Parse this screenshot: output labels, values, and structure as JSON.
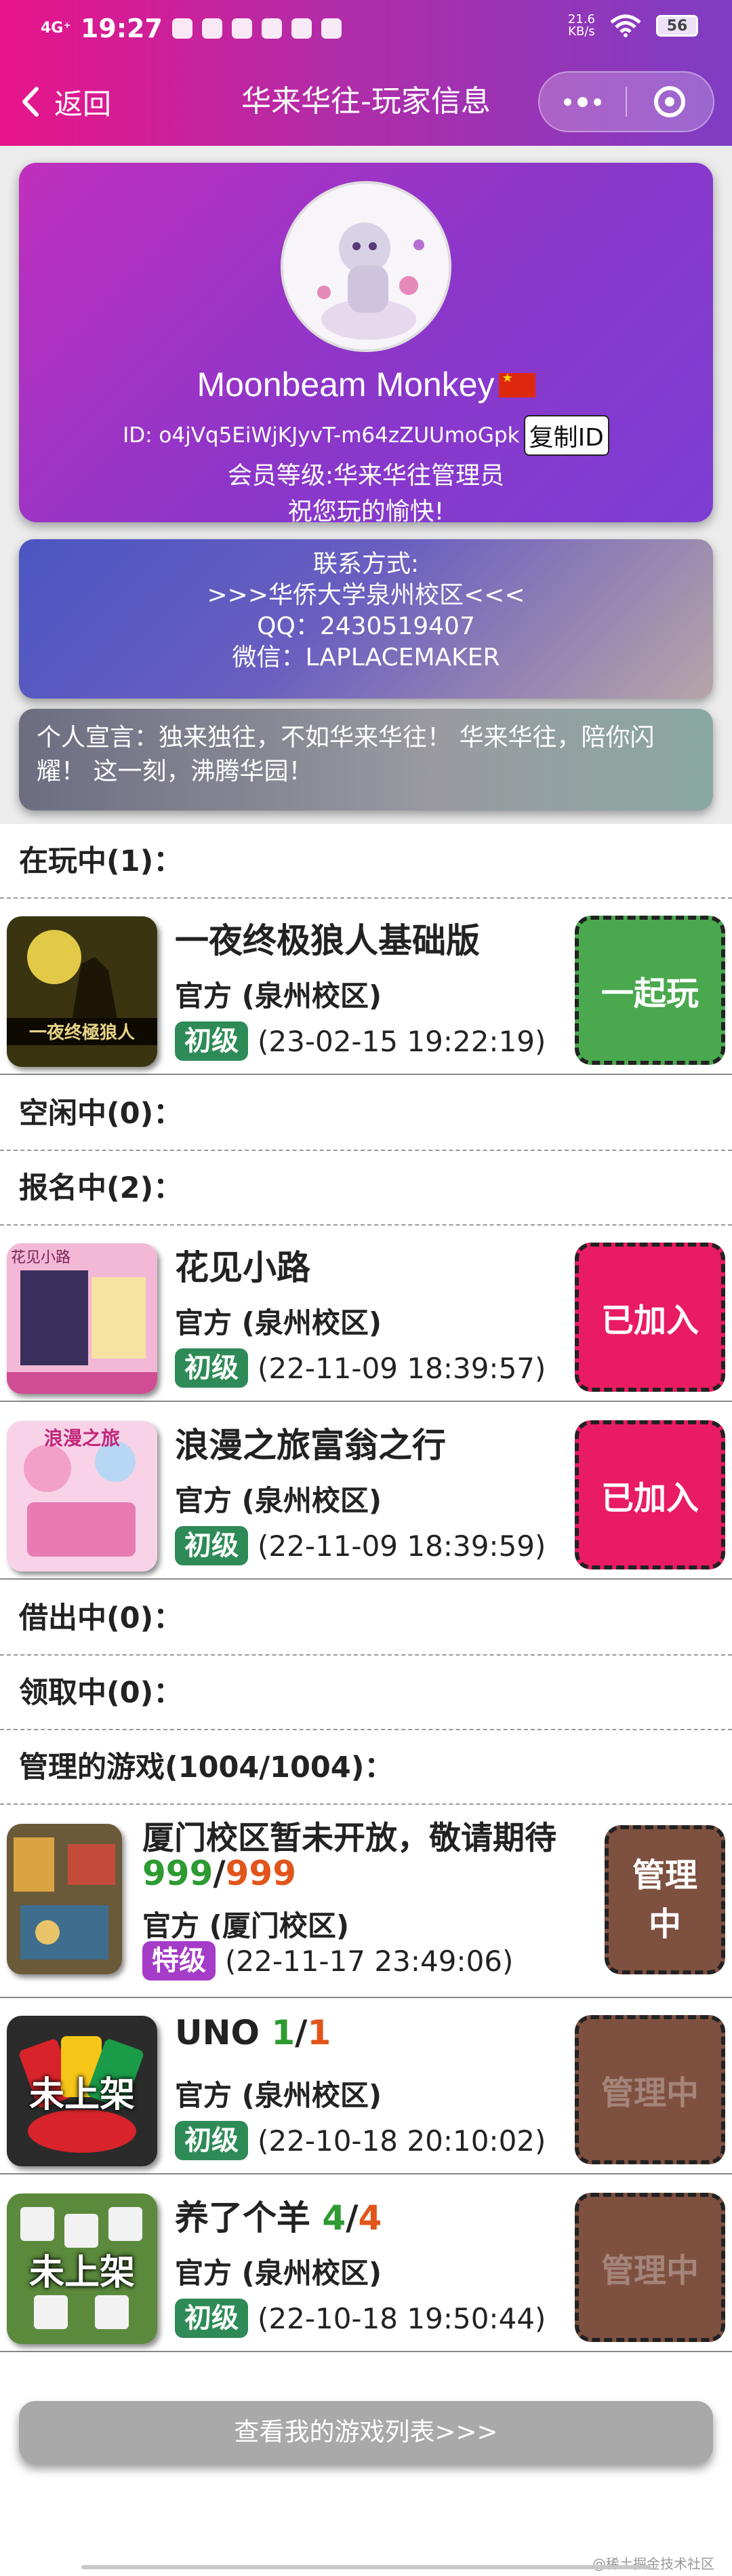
{
  "status_bar": {
    "network": "4G⁺",
    "time": "19:27",
    "netspeed_value": "21.6",
    "netspeed_unit": "KB/s",
    "battery": "56"
  },
  "nav": {
    "back_label": "返回",
    "title": "华来华往-玩家信息"
  },
  "profile": {
    "nickname": "Moonbeam Monkey",
    "id_text": "ID: o4jVq5EiWjKJyvT-m64zZUUmoGpk",
    "copy_id_label": "复制ID",
    "level_text": "会员等级:华来华往管理员",
    "greeting": "祝您玩的愉快!"
  },
  "contact": {
    "title": "联系方式:",
    "campus": ">>>华侨大学泉州校区<<<",
    "qq": "QQ：2430519407",
    "wechat": "微信：LAPLACEMAKER"
  },
  "motto": "个人宣言：独来独往，不如华来华往！ 华来华往，陪你闪耀！ 这一刻，沸腾华园！",
  "sections": {
    "playing": "在玩中(1)：",
    "idle": "空闲中(0)：",
    "signup": "报名中(2)：",
    "lending": "借出中(0)：",
    "receiving": "领取中(0)：",
    "managed": "管理的游戏(1004/1004)："
  },
  "playing_games": [
    {
      "name": "一夜终极狼人基础版",
      "owner": "官方 (泉州校区)",
      "level": "初级",
      "time": "(23-02-15 19:22:19)",
      "action": "一起玩",
      "cover_text": "一夜终極狼人"
    }
  ],
  "signup_games": [
    {
      "name": "花见小路",
      "owner": "官方 (泉州校区)",
      "level": "初级",
      "time": "(22-11-09 18:39:57)",
      "action": "已加入",
      "cover_text": "花见小路"
    },
    {
      "name": "浪漫之旅富翁之行",
      "owner": "官方 (泉州校区)",
      "level": "初级",
      "time": "(22-11-09 18:39:59)",
      "action": "已加入",
      "cover_text": "浪漫之旅"
    }
  ],
  "managed_games": [
    {
      "name": "厦门校区暂未开放，敬请期待",
      "count": "999",
      "total": "999",
      "owner": "官方 (厦门校区)",
      "level": "特级",
      "time": "(22-11-17 23:49:06)",
      "action_line1": "管理",
      "action_line2": "中"
    },
    {
      "name": "UNO",
      "count": "1",
      "total": "1",
      "owner": "官方 (泉州校区)",
      "level": "初级",
      "time": "(22-10-18 20:10:02)",
      "action": "管理中",
      "cover_text": "未上架"
    },
    {
      "name": "养了个羊",
      "count": "4",
      "total": "4",
      "owner": "官方 (泉州校区)",
      "level": "初级",
      "time": "(22-10-18 19:50:44)",
      "action": "管理中",
      "cover_text": "未上架"
    }
  ],
  "footer": {
    "list_button": "查看我的游戏列表>>>",
    "watermark": "@稀土掘金技术社区"
  },
  "colors": {
    "header_start": "#e8148a",
    "header_end": "#7e3dc4",
    "green_button": "#4aa84e",
    "red_button": "#e91b62",
    "brown_button": "#7e5040",
    "level_basic": "#2e8b57",
    "level_special": "#a53cc7",
    "count_green": "#2e9a32",
    "count_orange": "#e2551a"
  }
}
